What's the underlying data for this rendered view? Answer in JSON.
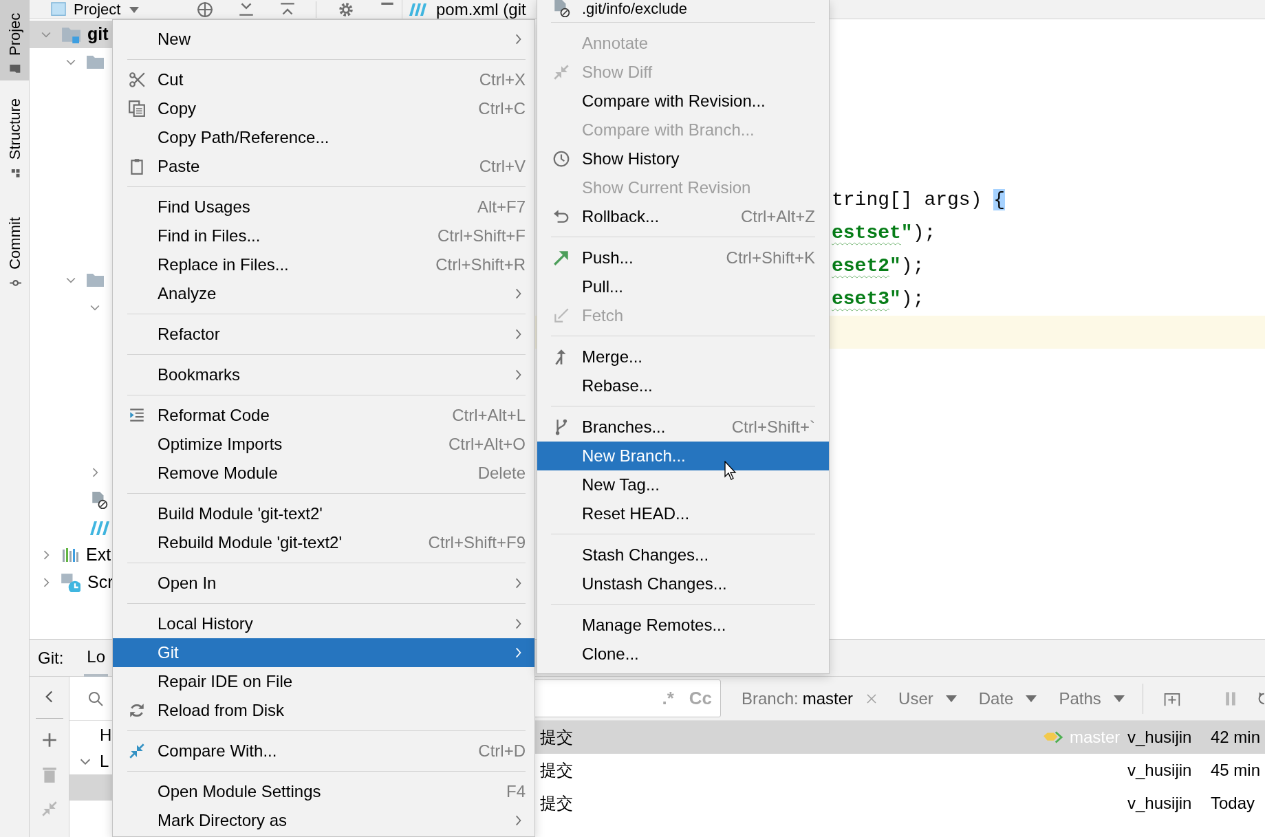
{
  "tool_strip": [
    {
      "label": "Projec",
      "selected": true
    },
    {
      "label": "Structure",
      "selected": false
    },
    {
      "label": "Commit",
      "selected": false
    }
  ],
  "project_panel": {
    "title": "Project",
    "tree": [
      {
        "label": "git",
        "selected": true,
        "expanded": true
      },
      {
        "label": "Ext",
        "selected": false,
        "expanded": false
      },
      {
        "label": "Scr",
        "selected": false,
        "expanded": false
      }
    ]
  },
  "editor": {
    "tabs": [
      {
        "label": "pom.xml (git"
      }
    ],
    "code_lines": [
      {
        "current": false,
        "segments": [
          {
            "text": "tring[] args) ",
            "kind": "plain"
          },
          {
            "text": "{",
            "kind": "brace_match"
          }
        ]
      },
      {
        "current": false,
        "segments": [
          {
            "text": "estset",
            "kind": "string_typo"
          },
          {
            "text": "\"",
            "kind": "string"
          },
          {
            "text": ");",
            "kind": "plain"
          }
        ]
      },
      {
        "current": false,
        "segments": [
          {
            "text": "eset2",
            "kind": "string_typo"
          },
          {
            "text": "\"",
            "kind": "string"
          },
          {
            "text": ");",
            "kind": "plain"
          }
        ]
      },
      {
        "current": false,
        "segments": [
          {
            "text": "eset3",
            "kind": "string_typo"
          },
          {
            "text": "\"",
            "kind": "string"
          },
          {
            "text": ");",
            "kind": "plain"
          }
        ]
      },
      {
        "current": true
      }
    ]
  },
  "context_menu": {
    "groups": [
      [
        {
          "label": "New",
          "submenu": true,
          "selected": false,
          "disabled": false
        }
      ],
      [
        {
          "label": "Cut",
          "shortcut": "Ctrl+X",
          "selected": false,
          "disabled": false
        },
        {
          "label": "Copy",
          "shortcut": "Ctrl+C",
          "selected": false,
          "disabled": false
        },
        {
          "label": "Copy Path/Reference...",
          "selected": false,
          "disabled": false
        },
        {
          "label": "Paste",
          "shortcut": "Ctrl+V",
          "selected": false,
          "disabled": false
        }
      ],
      [
        {
          "label": "Find Usages",
          "shortcut": "Alt+F7",
          "selected": false,
          "disabled": false
        },
        {
          "label": "Find in Files...",
          "shortcut": "Ctrl+Shift+F",
          "selected": false,
          "disabled": false
        },
        {
          "label": "Replace in Files...",
          "shortcut": "Ctrl+Shift+R",
          "selected": false,
          "disabled": false
        },
        {
          "label": "Analyze",
          "submenu": true,
          "selected": false,
          "disabled": false
        }
      ],
      [
        {
          "label": "Refactor",
          "submenu": true,
          "selected": false,
          "disabled": false
        }
      ],
      [
        {
          "label": "Bookmarks",
          "submenu": true,
          "selected": false,
          "disabled": false
        }
      ],
      [
        {
          "label": "Reformat Code",
          "shortcut": "Ctrl+Alt+L",
          "selected": false,
          "disabled": false
        },
        {
          "label": "Optimize Imports",
          "shortcut": "Ctrl+Alt+O",
          "selected": false,
          "disabled": false
        },
        {
          "label": "Remove Module",
          "shortcut": "Delete",
          "selected": false,
          "disabled": false
        }
      ],
      [
        {
          "label": "Build Module 'git-text2'",
          "selected": false,
          "disabled": false
        },
        {
          "label": "Rebuild Module 'git-text2'",
          "shortcut": "Ctrl+Shift+F9",
          "selected": false,
          "disabled": false
        }
      ],
      [
        {
          "label": "Open In",
          "submenu": true,
          "selected": false,
          "disabled": false
        }
      ],
      [
        {
          "label": "Local History",
          "submenu": true,
          "selected": false,
          "disabled": false
        },
        {
          "label": "Git",
          "submenu": true,
          "selected": true,
          "disabled": false
        },
        {
          "label": "Repair IDE on File",
          "selected": false,
          "disabled": false
        },
        {
          "label": "Reload from Disk",
          "selected": false,
          "disabled": false
        }
      ],
      [
        {
          "label": "Compare With...",
          "shortcut": "Ctrl+D",
          "selected": false,
          "disabled": false
        }
      ],
      [
        {
          "label": "Open Module Settings",
          "shortcut": "F4",
          "selected": false,
          "disabled": false
        },
        {
          "label": "Mark Directory as",
          "submenu": true,
          "selected": false,
          "disabled": false
        }
      ]
    ]
  },
  "git_submenu": {
    "groups": [
      [
        {
          "label": ".git/info/exclude",
          "selected": false,
          "disabled": false
        }
      ],
      [
        {
          "label": "Annotate",
          "selected": false,
          "disabled": true
        },
        {
          "label": "Show Diff",
          "selected": false,
          "disabled": true
        },
        {
          "label": "Compare with Revision...",
          "selected": false,
          "disabled": false
        },
        {
          "label": "Compare with Branch...",
          "selected": false,
          "disabled": true
        },
        {
          "label": "Show History",
          "selected": false,
          "disabled": false
        },
        {
          "label": "Show Current Revision",
          "selected": false,
          "disabled": true
        },
        {
          "label": "Rollback...",
          "shortcut": "Ctrl+Alt+Z",
          "selected": false,
          "disabled": false
        }
      ],
      [
        {
          "label": "Push...",
          "shortcut": "Ctrl+Shift+K",
          "selected": false,
          "disabled": false
        },
        {
          "label": "Pull...",
          "selected": false,
          "disabled": false
        },
        {
          "label": "Fetch",
          "selected": false,
          "disabled": true
        }
      ],
      [
        {
          "label": "Merge...",
          "selected": false,
          "disabled": false
        },
        {
          "label": "Rebase...",
          "selected": false,
          "disabled": false
        }
      ],
      [
        {
          "label": "Branches...",
          "shortcut": "Ctrl+Shift+`",
          "selected": false,
          "disabled": false
        },
        {
          "label": "New Branch...",
          "selected": true,
          "disabled": false
        },
        {
          "label": "New Tag...",
          "selected": false,
          "disabled": false
        },
        {
          "label": "Reset HEAD...",
          "selected": false,
          "disabled": false
        }
      ],
      [
        {
          "label": "Stash Changes...",
          "selected": false,
          "disabled": false
        },
        {
          "label": "Unstash Changes...",
          "selected": false,
          "disabled": false
        }
      ],
      [
        {
          "label": "Manage Remotes...",
          "selected": false,
          "disabled": false
        },
        {
          "label": "Clone...",
          "selected": false,
          "disabled": false
        }
      ]
    ]
  },
  "bottom_panel": {
    "title": "Git:",
    "tabs": [
      {
        "label": "Lo",
        "selected": true
      }
    ],
    "branches": [
      {
        "label": "H",
        "selected": false
      },
      {
        "label": "L",
        "selected": false,
        "expanded": true,
        "children": [
          {
            "selected": true
          }
        ]
      }
    ],
    "field_toggles": [
      ".*",
      "Cc"
    ],
    "filters": [
      {
        "kind": "value",
        "label": "Branch:",
        "value": "master"
      },
      {
        "kind": "dropdown",
        "label": "User"
      },
      {
        "kind": "dropdown",
        "label": "Date"
      },
      {
        "kind": "dropdown",
        "label": "Paths"
      }
    ],
    "log_rows": [
      {
        "subject": "提交",
        "ref": "master",
        "author": "v_husijin",
        "date": "42 min",
        "selected": true
      },
      {
        "subject": "提交",
        "author": "v_husijin",
        "date": "45 min",
        "selected": false
      },
      {
        "subject": "提交",
        "author": "v_husijin",
        "date": "Today",
        "selected": false
      }
    ]
  }
}
